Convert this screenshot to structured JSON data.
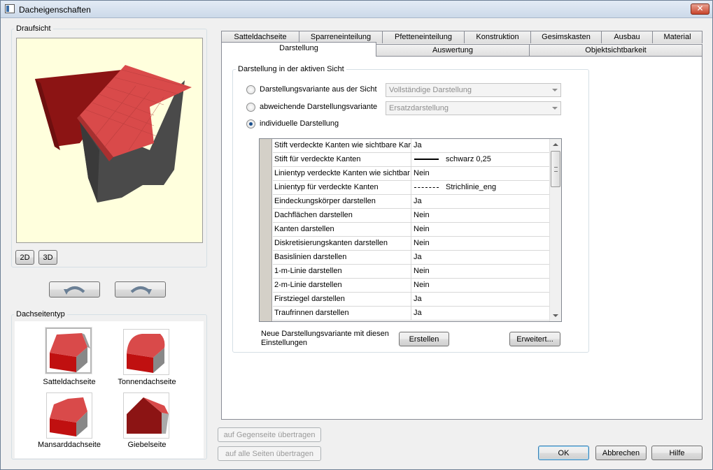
{
  "window": {
    "title": "Dacheigenschaften",
    "close_label": "✕"
  },
  "left": {
    "top_view_label": "Draufsicht",
    "view_buttons": {
      "btn_2d": "2D",
      "btn_3d": "3D"
    },
    "roof_type_label": "Dachseitentyp",
    "roof_types": [
      {
        "label": "Satteldachseite",
        "selected": true
      },
      {
        "label": "Tonnendachseite",
        "selected": false
      },
      {
        "label": "Mansarddachseite",
        "selected": false
      },
      {
        "label": "Giebelseite",
        "selected": false
      }
    ]
  },
  "tabs": {
    "row1": [
      "Satteldachseite",
      "Sparreneinteilung",
      "Pfetteneinteilung",
      "Konstruktion",
      "Gesimskasten",
      "Ausbau",
      "Material"
    ],
    "row2": [
      "Darstellung",
      "Auswertung",
      "Objektsichtbarkeit"
    ],
    "active": "Darstellung"
  },
  "display": {
    "group_label": "Darstellung in der aktiven Sicht",
    "options": [
      {
        "label": "Darstellungsvariante aus der Sicht",
        "checked": false,
        "combo": "Vollständige Darstellung"
      },
      {
        "label": "abweichende Darstellungsvariante",
        "checked": false,
        "combo": "Ersatzdarstellung"
      },
      {
        "label": "individuelle Darstellung",
        "checked": true
      }
    ],
    "properties": [
      {
        "name": "Stift verdeckte Kanten wie sichtbare Kar",
        "value": "Ja"
      },
      {
        "name": "Stift für verdeckte Kanten",
        "value": "schwarz 0,25",
        "line": "solid"
      },
      {
        "name": "Linientyp verdeckte Kanten wie sichtbar",
        "value": "Nein"
      },
      {
        "name": "Linientyp für verdeckte Kanten",
        "value": "Strichlinie_eng",
        "line": "dash"
      },
      {
        "name": "Eindeckungskörper darstellen",
        "value": "Ja"
      },
      {
        "name": "Dachflächen darstellen",
        "value": "Nein"
      },
      {
        "name": "Kanten darstellen",
        "value": "Nein"
      },
      {
        "name": "Diskretisierungskanten darstellen",
        "value": "Nein"
      },
      {
        "name": "Basislinien darstellen",
        "value": "Ja"
      },
      {
        "name": "1-m-Linie darstellen",
        "value": "Nein"
      },
      {
        "name": "2-m-Linie darstellen",
        "value": "Nein"
      },
      {
        "name": "Firstziegel darstellen",
        "value": "Ja"
      },
      {
        "name": "Traufrinnen darstellen",
        "value": "Ja"
      }
    ],
    "new_variant_text": "Neue Darstellungsvariante mit diesen Einstellungen",
    "create_button": "Erstellen",
    "advanced_button": "Erweitert..."
  },
  "bottom": {
    "transfer_opposite": "auf Gegenseite übertragen",
    "transfer_all": "auf alle Seiten übertragen",
    "ok": "OK",
    "cancel": "Abbrechen",
    "help": "Hilfe"
  },
  "colors": {
    "roof_red": "#d94a4a",
    "roof_dark": "#8c1414",
    "wall": "#4a4a4a",
    "preview_bg": "#ffffdd"
  }
}
